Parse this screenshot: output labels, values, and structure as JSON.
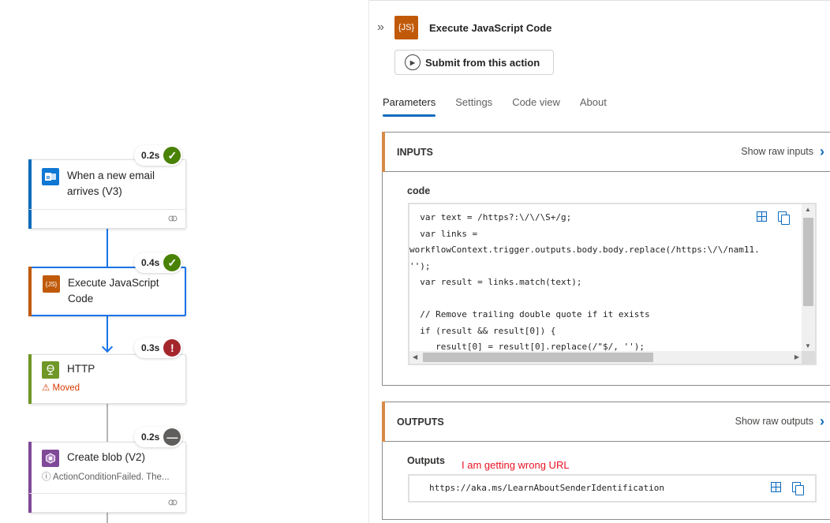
{
  "canvas": {
    "nodes": [
      {
        "title": "When a new email arrives (V3)",
        "icon": "outlook-icon",
        "accent": "#0f6cbd",
        "icon_bg": "#0f78d4",
        "duration": "0.2s",
        "status": "succeeded",
        "status_color": "#498205",
        "status_glyph": "✓"
      },
      {
        "title": "Execute JavaScript Code",
        "icon": "javascript-icon",
        "icon_label": "{JS}",
        "accent": "#c05a0a",
        "icon_bg": "#c05a0a",
        "duration": "0.4s",
        "status": "succeeded",
        "status_color": "#498205",
        "status_glyph": "✓",
        "selected": true
      },
      {
        "title": "HTTP",
        "icon": "globe-icon",
        "accent": "#709727",
        "icon_bg": "#709727",
        "duration": "0.3s",
        "status": "failed",
        "status_color": "#a4262c",
        "status_glyph": "!",
        "subtitle": "⚠ Moved"
      },
      {
        "title": "Create blob (V2)",
        "icon": "blob-storage-icon",
        "accent": "#804998",
        "icon_bg": "#804998",
        "duration": "0.2s",
        "status": "skipped",
        "status_color": "#605e5c",
        "status_glyph": "—",
        "subtitle": "ⓘ ActionConditionFailed. The..."
      }
    ]
  },
  "panel": {
    "collapse_glyph": "»",
    "icon_label": "{JS}",
    "title": "Execute JavaScript Code",
    "submit_label": "Submit from this action",
    "tabs": [
      {
        "label": "Parameters",
        "active": true
      },
      {
        "label": "Settings",
        "active": false
      },
      {
        "label": "Code view",
        "active": false
      },
      {
        "label": "About",
        "active": false
      }
    ],
    "inputs": {
      "title": "INPUTS",
      "raw_link": "Show raw inputs",
      "field_label": "code",
      "code_lines": [
        "  var text = /https?:\\/\\/\\S+/g;",
        "  var links =",
        "workflowContext.trigger.outputs.body.body.replace(/https:\\/\\/nam11.",
        "'');",
        "  var result = links.match(text);",
        "",
        "  // Remove trailing double quote if it exists",
        "  if (result && result[0]) {",
        "     result[0] = result[0].replace(/\"$/, '');"
      ]
    },
    "outputs": {
      "title": "OUTPUTS",
      "raw_link": "Show raw outputs",
      "field_label": "Outputs",
      "annotation": "I am getting wrong URL",
      "value": "https://aka.ms/LearnAboutSenderIdentification"
    },
    "chevron_glyph": "›"
  }
}
